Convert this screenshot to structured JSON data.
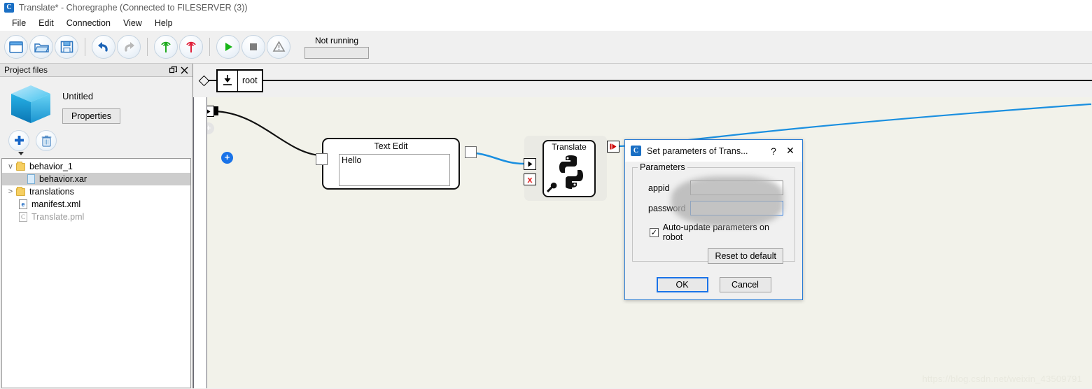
{
  "window": {
    "title": "Translate* - Choregraphe (Connected to FILESERVER (3))",
    "app_icon": "C"
  },
  "menubar": {
    "items": [
      {
        "label": "File"
      },
      {
        "label": "Edit"
      },
      {
        "label": "Connection"
      },
      {
        "label": "View"
      },
      {
        "label": "Help"
      }
    ]
  },
  "toolbar": {
    "buttons": [
      {
        "name": "new-window-icon"
      },
      {
        "name": "open-folder-icon"
      },
      {
        "name": "save-icon"
      },
      {
        "name": "undo-icon"
      },
      {
        "name": "redo-icon"
      },
      {
        "name": "connect-icon"
      },
      {
        "name": "disconnect-icon"
      },
      {
        "name": "play-icon"
      },
      {
        "name": "stop-icon"
      },
      {
        "name": "warning-icon"
      }
    ],
    "status_label": "Not running",
    "progress_value": ""
  },
  "project_panel": {
    "title": "Project files",
    "float_icon": "float-icon",
    "close_icon": "close-icon",
    "project_name": "Untitled",
    "properties_label": "Properties",
    "add_label": "+",
    "delete_label": "trash",
    "tree": [
      {
        "label": "behavior_1",
        "kind": "folder",
        "twist": "v",
        "indent": 0,
        "selected": false,
        "dim": false
      },
      {
        "label": "behavior.xar",
        "kind": "doc",
        "twist": "",
        "indent": 1,
        "selected": true,
        "dim": false
      },
      {
        "label": "translations",
        "kind": "folder",
        "twist": ">",
        "indent": 0,
        "selected": false,
        "dim": false
      },
      {
        "label": "manifest.xml",
        "kind": "xml",
        "twist": "",
        "indent": 0,
        "selected": false,
        "dim": false
      },
      {
        "label": "Translate.pml",
        "kind": "pml",
        "twist": "",
        "indent": 0,
        "selected": false,
        "dim": true
      }
    ]
  },
  "breadcrumb": {
    "root_label": "root",
    "root_icon": "anchor-icon"
  },
  "canvas": {
    "text_edit_node": {
      "title": "Text Edit",
      "value": "Hello"
    },
    "translate_node": {
      "title": "Translate",
      "body_icon": "python-icon",
      "tool_icon": "wrench-icon",
      "error_port": "x"
    },
    "watermark": "https://blog.csdn.net/weixin_43509791"
  },
  "dialog": {
    "icon": "C",
    "title": "Set parameters of Trans...",
    "help_label": "?",
    "close_label": "✕",
    "group_legend": "Parameters",
    "fields": [
      {
        "label": "appid",
        "value": "",
        "focused": false
      },
      {
        "label": "password",
        "value": "",
        "focused": true
      }
    ],
    "checkbox": {
      "label": "Auto-update parameters on robot",
      "checked": true,
      "mark": "✓"
    },
    "reset_label": "Reset to default",
    "ok_label": "OK",
    "cancel_label": "Cancel"
  },
  "colors": {
    "accent_blue": "#1a73e8",
    "canvas_bg": "#f2f2ea",
    "chrome_bg": "#f0f0f0",
    "link_blue": "#1a8fe0",
    "error_red": "#e11d1d"
  }
}
